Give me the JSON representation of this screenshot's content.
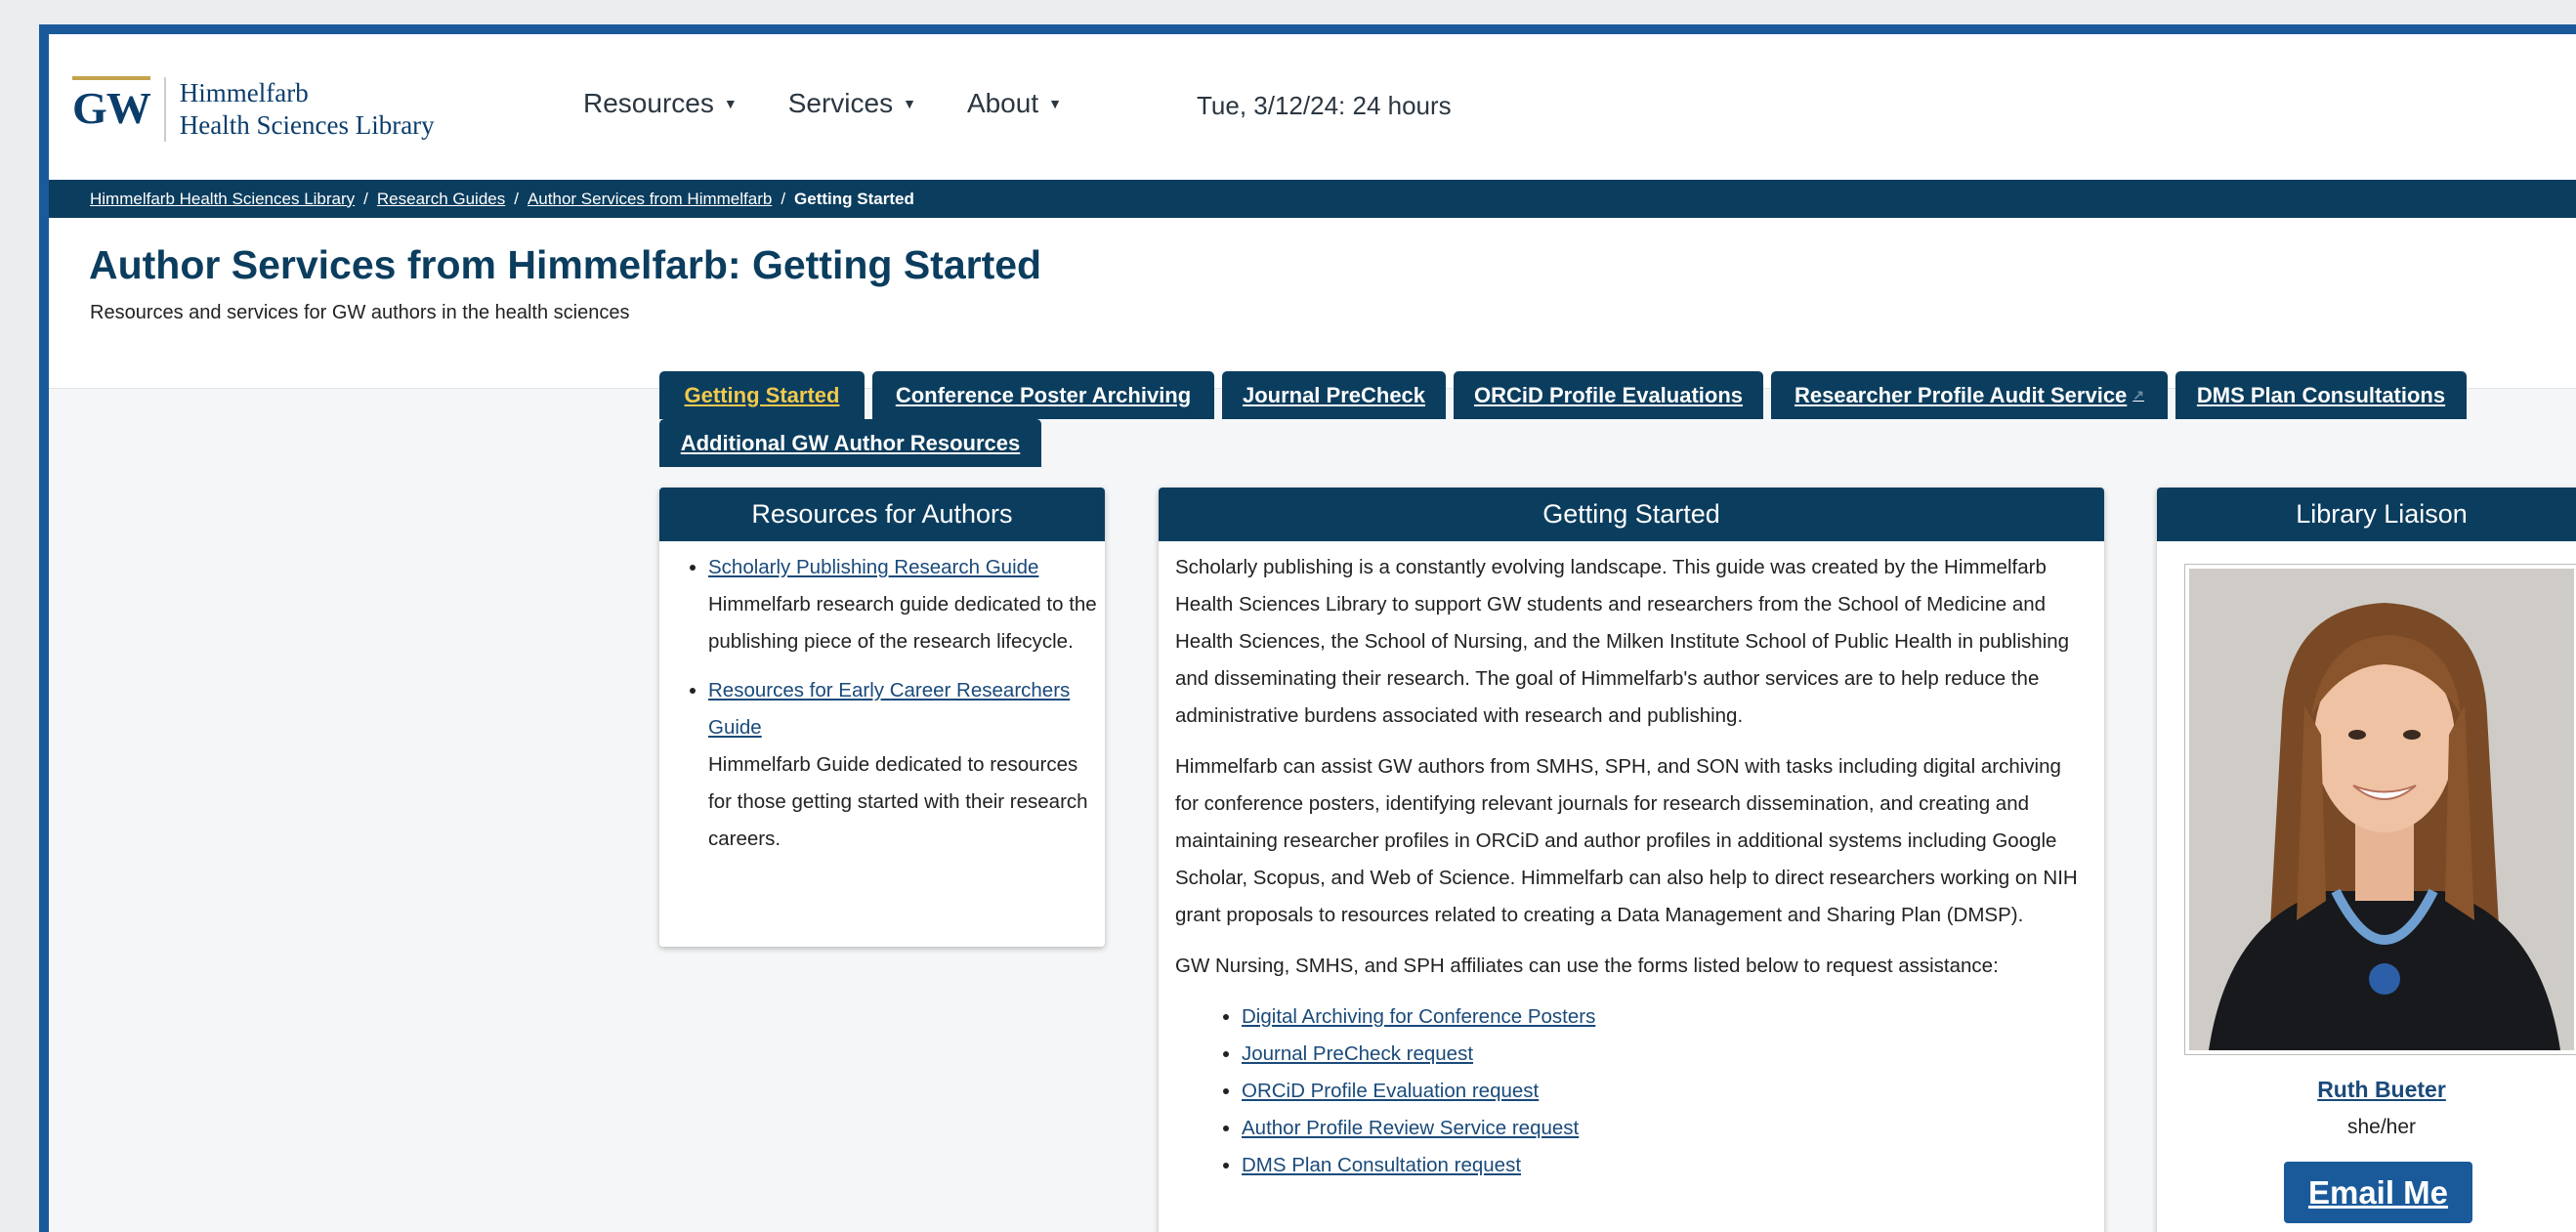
{
  "header": {
    "logo_mark": "GW",
    "logo_line1": "Himmelfarb",
    "logo_line2": "Health Sciences Library",
    "nav": [
      {
        "label": "Resources"
      },
      {
        "label": "Services"
      },
      {
        "label": "About"
      }
    ],
    "hours": "Tue, 3/12/24: 24 hours"
  },
  "breadcrumb": {
    "items": [
      "Himmelfarb Health Sciences Library",
      "Research Guides",
      "Author Services from Himmelfarb"
    ],
    "current": "Getting Started",
    "separator": "/"
  },
  "page": {
    "title": "Author Services from Himmelfarb: Getting Started",
    "subtitle": "Resources and services for GW authors in the health sciences"
  },
  "tabs": [
    {
      "label": "Getting Started",
      "active": true
    },
    {
      "label": "Conference Poster Archiving"
    },
    {
      "label": "Journal PreCheck"
    },
    {
      "label": "ORCiD Profile Evaluations"
    },
    {
      "label": "Researcher Profile Audit Service"
    },
    {
      "label": "DMS Plan Consultations"
    },
    {
      "label": "Additional GW Author Resources"
    }
  ],
  "resources_box": {
    "title": "Resources for Authors",
    "items": [
      {
        "link": "Scholarly Publishing Research Guide",
        "desc": "Himmelfarb research guide dedicated to the publishing piece of the research lifecycle."
      },
      {
        "link": "Resources for Early Career Researchers Guide",
        "desc": "Himmelfarb Guide dedicated to resources for those getting started with their research careers."
      }
    ]
  },
  "getting_started_box": {
    "title": "Getting Started",
    "paragraphs": [
      "Scholarly publishing is a constantly evolving landscape. This guide was created by the Himmelfarb Health Sciences Library to support GW students and researchers from the School of Medicine and Health Sciences, the School of Nursing, and the Milken Institute School of Public Health in publishing and disseminating their research. The goal of Himmelfarb's author services are to help reduce the administrative burdens associated with research and publishing.",
      "Himmelfarb can assist GW authors from SMHS, SPH, and SON with tasks including digital archiving for conference posters, identifying relevant  journals for research dissemination, and creating and maintaining researcher profiles in ORCiD  and author profiles in additional systems including Google Scholar, Scopus, and Web of Science. Himmelfarb can also help to direct researchers working on NIH grant proposals to resources related to creating a Data Management and Sharing Plan (DMSP).",
      "GW Nursing, SMHS, and SPH affiliates can use the forms listed below to request assistance:"
    ],
    "links": [
      "Digital Archiving for Conference Posters",
      "Journal PreCheck request",
      "ORCiD Profile Evaluation request",
      "Author Profile Review Service request",
      "DMS Plan Consultation request"
    ]
  },
  "liaison_box": {
    "title": "Library Liaison",
    "name": "Ruth Bueter",
    "pronouns": "she/her",
    "email_label": "Email Me"
  }
}
